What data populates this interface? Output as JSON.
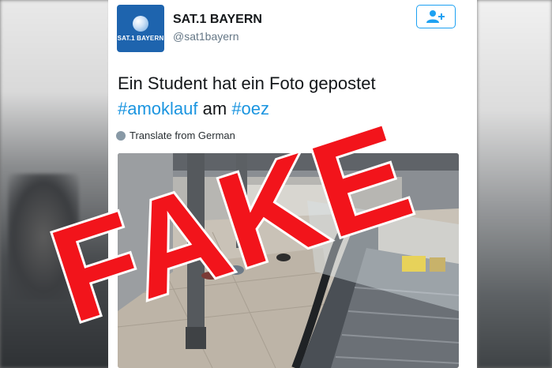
{
  "account": {
    "display_name": "SAT.1 BAYERN",
    "handle": "@sat1bayern",
    "avatar_text": "SAT.1 BAYERN"
  },
  "tweet": {
    "text_line1": "Ein Student hat ein Foto gepostet",
    "hashtag1": "#amoklauf",
    "text_am": " am ",
    "hashtag2": "#oez",
    "translate_label": "Translate from German"
  },
  "overlay": {
    "stamp_text": "FAKE",
    "stamp_color": "#f2141b"
  },
  "colors": {
    "hashtag": "#1b95e0",
    "follow_border": "#1da1f2",
    "avatar_bg": "#1e64ae"
  },
  "icons": {
    "follow": "person-plus-icon",
    "translate": "globe-icon"
  }
}
